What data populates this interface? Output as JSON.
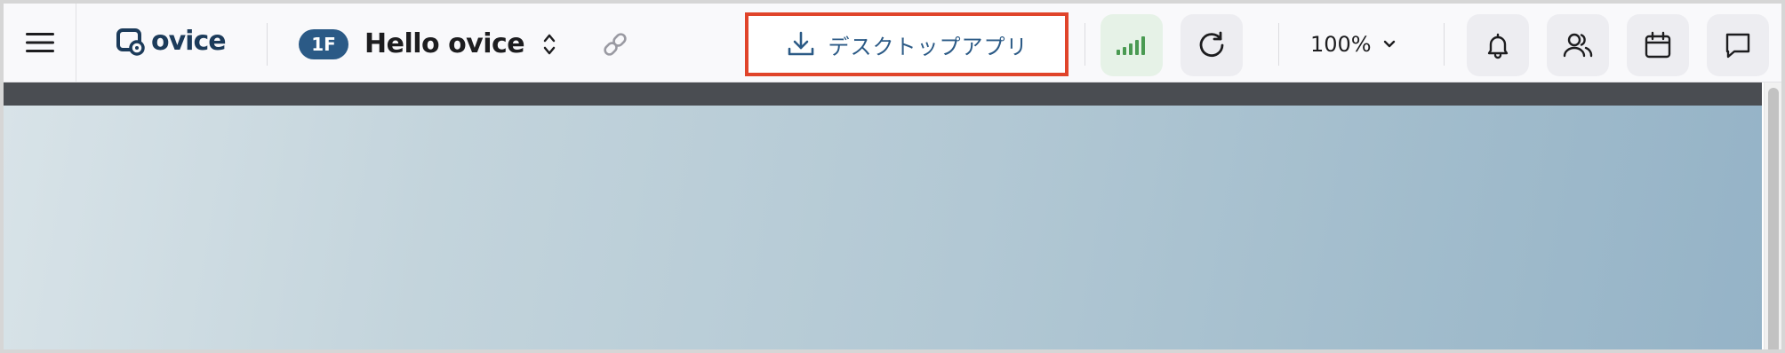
{
  "toolbar": {
    "logo_text": "ovice",
    "floor_badge": "1F",
    "space_name": "Hello ovice",
    "desktop_app_label": "デスクトップアプリ",
    "zoom_level": "100%",
    "colors": {
      "brand": "#2b5a86",
      "highlight_border": "#e0442a",
      "signal_green": "#4a9a52"
    },
    "icons": {
      "menu": "hamburger-menu-icon",
      "space_switch": "chevron-up-down-icon",
      "link": "link-icon",
      "download": "download-icon",
      "signal": "signal-strength-icon",
      "refresh": "refresh-icon",
      "zoom_dropdown": "chevron-down-icon",
      "notifications": "bell-icon",
      "members": "people-icon",
      "calendar": "calendar-icon",
      "chat": "chat-icon"
    }
  }
}
